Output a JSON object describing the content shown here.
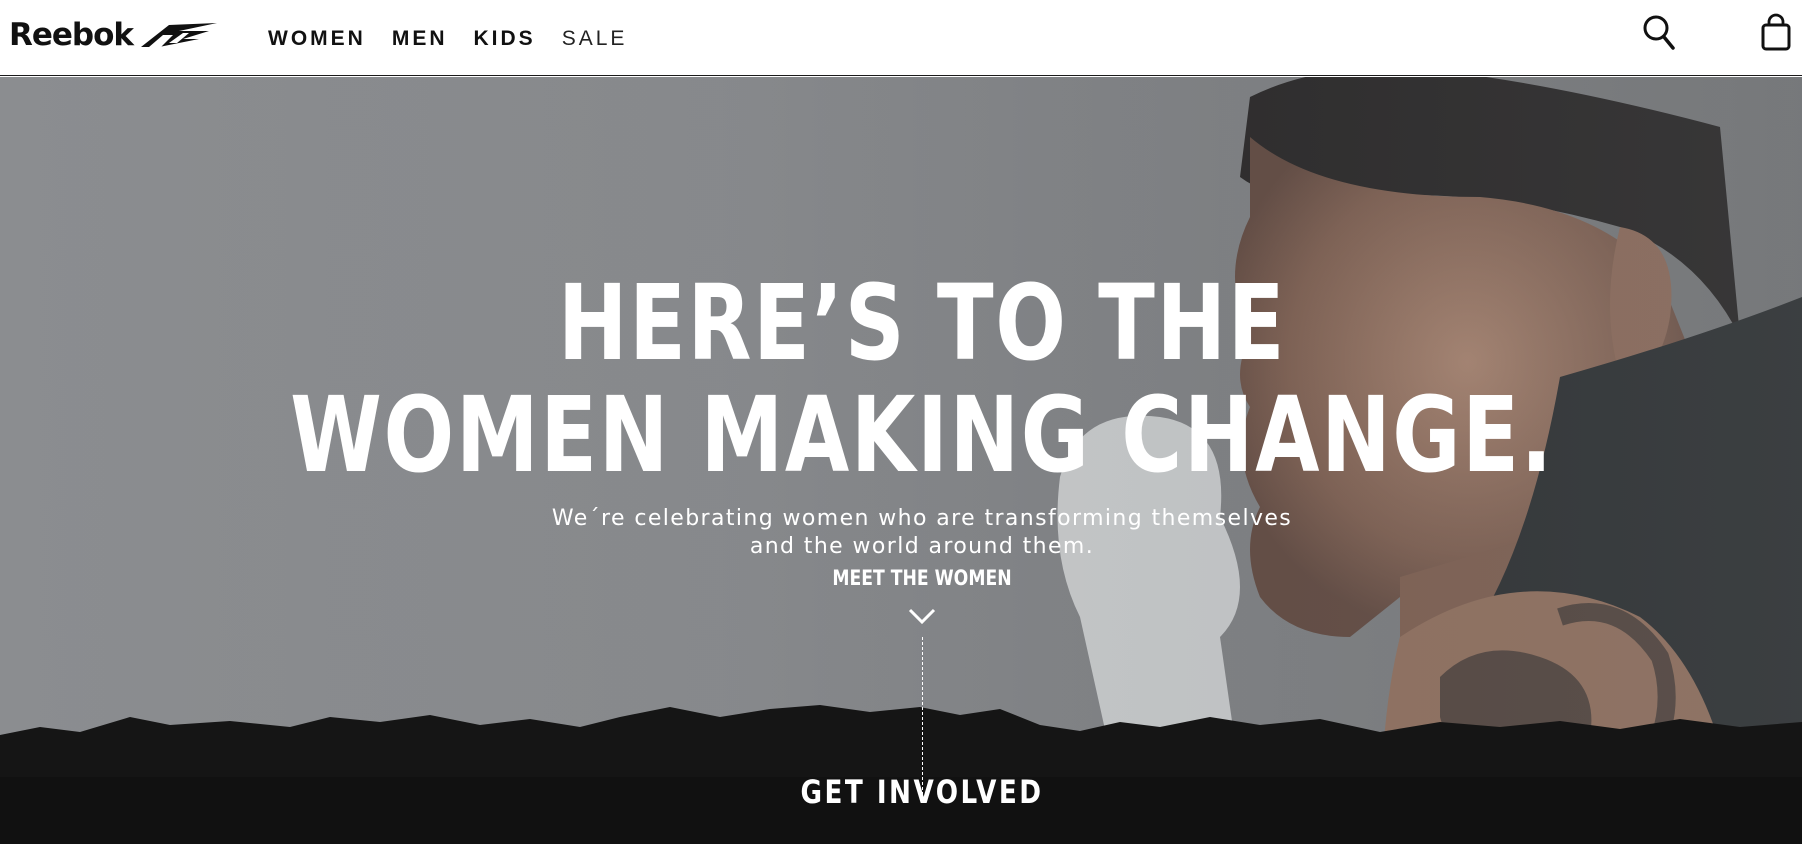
{
  "header": {
    "logo_text": "Reebok",
    "nav": [
      {
        "label": "WOMEN"
      },
      {
        "label": "MEN"
      },
      {
        "label": "KIDS"
      },
      {
        "label": "SALE"
      }
    ],
    "icons": [
      "search-icon",
      "shopping-bag-icon"
    ]
  },
  "hero": {
    "headline_line1": "HERE’S TO THE",
    "headline_line2": "WOMEN MAKING CHANGE.",
    "subtext": "We´re celebrating women who are transforming themselves and the world around them.",
    "cta": "MEET THE WOMEN",
    "scroll_icon": "chevron-down-icon",
    "banner_cta": "GET INVOLVED"
  },
  "colors": {
    "header_bg": "#ffffff",
    "text_dark": "#111111",
    "hero_gray": "#86888b",
    "banner_black": "#151515",
    "white": "#ffffff"
  }
}
